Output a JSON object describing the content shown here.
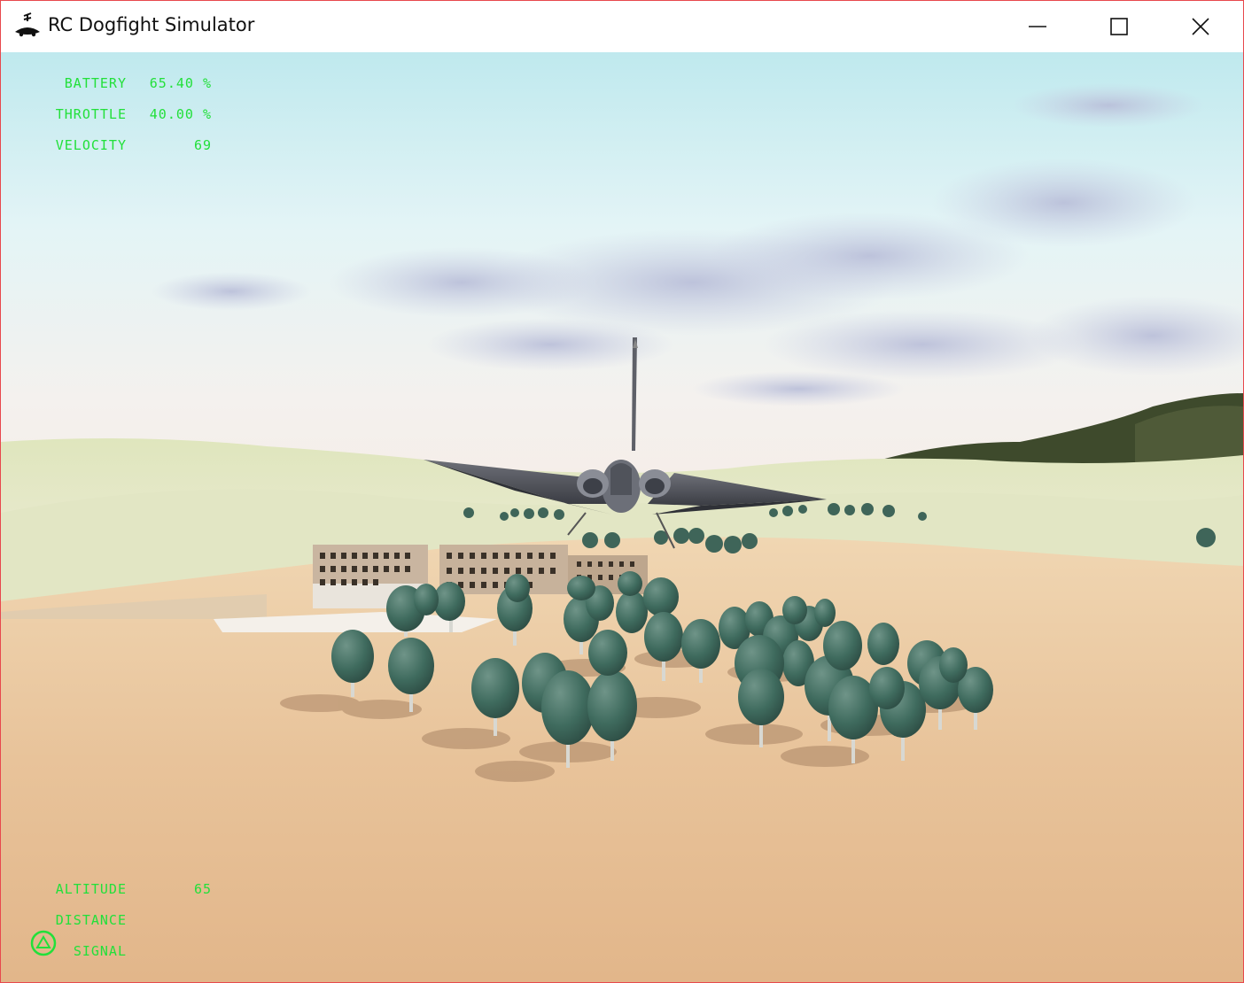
{
  "window": {
    "title": "RC Dogfight Simulator",
    "icon": "rc-plane-icon",
    "controls": {
      "minimize": "minimize-icon",
      "maximize": "maximize-icon",
      "close": "close-icon"
    },
    "border_color": "#e8484d"
  },
  "hud": {
    "color": "#22e03a",
    "battery": {
      "label": "BATTERY",
      "value": "65.40 %"
    },
    "throttle": {
      "label": "THROTTLE",
      "value": "40.00 %"
    },
    "velocity": {
      "label": "VELOCITY",
      "value": "69"
    },
    "altitude": {
      "label": "ALTITUDE",
      "value": "65"
    },
    "distance": {
      "label": "DISTANCE",
      "value": ""
    },
    "signal": {
      "label": "SIGNAL",
      "icon": "signal-triangle-icon"
    }
  }
}
